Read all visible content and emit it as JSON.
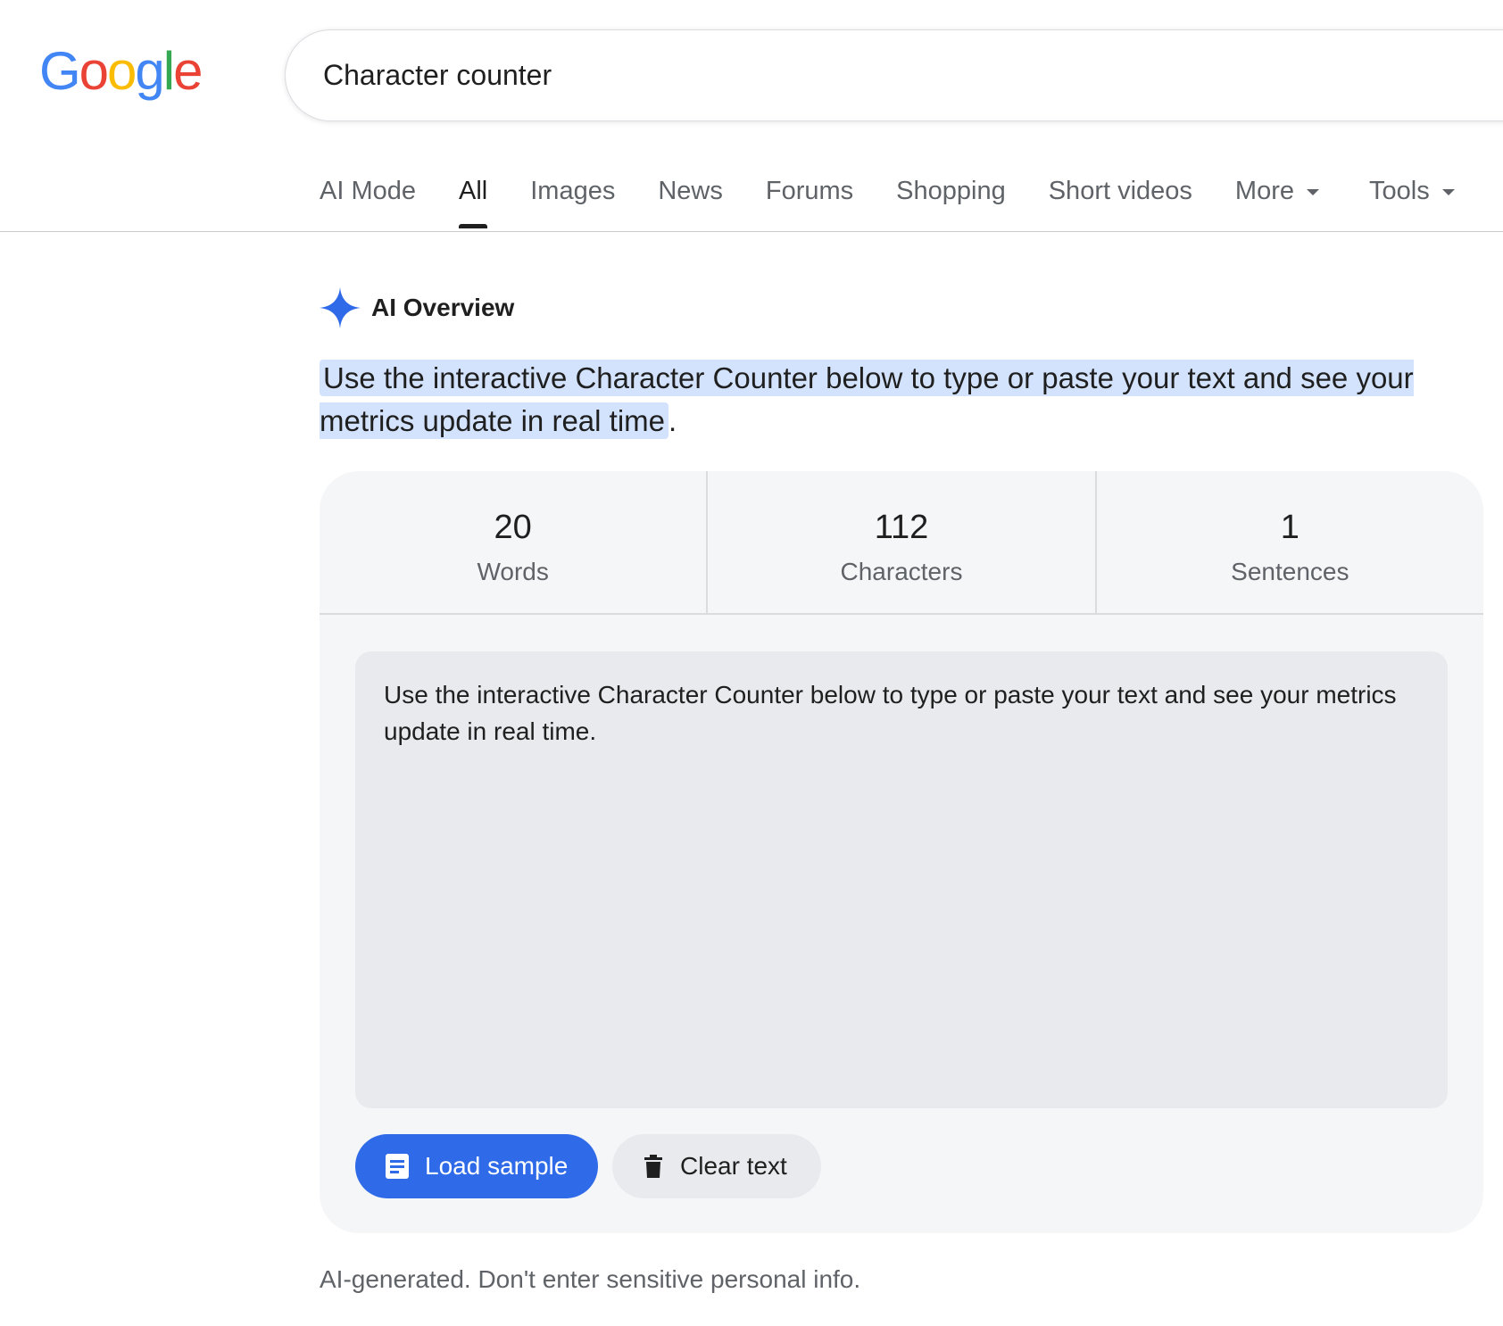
{
  "logo": {
    "letters": [
      "G",
      "o",
      "o",
      "g",
      "l",
      "e"
    ],
    "colors": [
      "#4285F4",
      "#EA4335",
      "#FBBC05",
      "#4285F4",
      "#34A853",
      "#EA4335"
    ]
  },
  "search": {
    "value": "Character counter"
  },
  "tabs": {
    "ai_mode": "AI Mode",
    "all": "All",
    "images": "Images",
    "news": "News",
    "forums": "Forums",
    "shopping": "Shopping",
    "short_videos": "Short videos",
    "more": "More",
    "tools": "Tools",
    "active": "all"
  },
  "ai_overview": {
    "label": "AI Overview",
    "intro_highlight": "Use the interactive Character Counter below to type or paste your text and see your metrics update in real time",
    "intro_tail": "."
  },
  "counter": {
    "stats": [
      {
        "value": "20",
        "label": "Words"
      },
      {
        "value": "112",
        "label": "Characters"
      },
      {
        "value": "1",
        "label": "Sentences"
      }
    ],
    "text": "Use the interactive Character Counter below to type or paste your text and see your metrics update in real time.",
    "load_sample_label": "Load sample",
    "clear_text_label": "Clear text"
  },
  "disclaimer": "AI-generated. Don't enter sensitive personal info.",
  "colors": {
    "accent": "#2f6ae8",
    "highlight": "#d3e3fd",
    "sparkle": "#2f6ae8"
  }
}
